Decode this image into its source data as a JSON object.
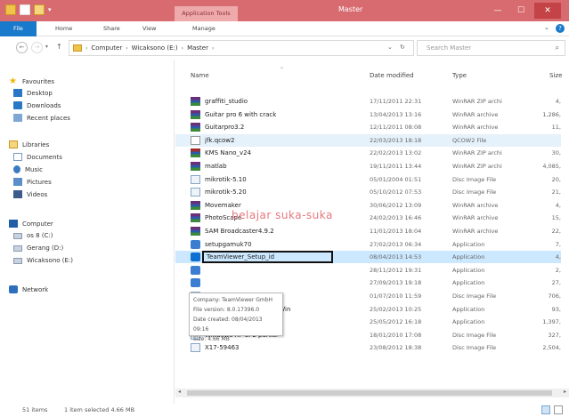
{
  "titlebar": {
    "contextual_tab": "Application Tools",
    "window_title": "Master",
    "minimize": "—",
    "maximize": "☐",
    "close": "✕"
  },
  "ribbon": {
    "tabs": [
      "File",
      "Home",
      "Share",
      "View",
      "Manage"
    ]
  },
  "address": {
    "path": [
      "Computer",
      "Wicaksono (E:)",
      "Master"
    ],
    "search_placeholder": "Search Master"
  },
  "nav": {
    "items": [
      {
        "label": "Favourites",
        "icon": "star-icon"
      },
      {
        "label": "Desktop",
        "icon": "desktop-icon"
      },
      {
        "label": "Downloads",
        "icon": "downloads-icon"
      },
      {
        "label": "Recent places",
        "icon": "recent-places-icon"
      },
      {
        "label": "Libraries",
        "icon": "libraries-icon"
      },
      {
        "label": "Documents",
        "icon": "documents-icon"
      },
      {
        "label": "Music",
        "icon": "music-icon"
      },
      {
        "label": "Pictures",
        "icon": "pictures-icon"
      },
      {
        "label": "Videos",
        "icon": "videos-icon"
      },
      {
        "label": "Computer",
        "icon": "computer-icon"
      },
      {
        "label": "os 8 (C:)",
        "icon": "drive-icon"
      },
      {
        "label": "Gerang (D:)",
        "icon": "drive-icon"
      },
      {
        "label": "Wicaksono (E:)",
        "icon": "drive-icon"
      },
      {
        "label": "Network",
        "icon": "network-icon"
      }
    ]
  },
  "columns": {
    "name": "Name",
    "date": "Date modified",
    "type": "Type",
    "size": "Size"
  },
  "files": [
    {
      "name": "graffiti_studio",
      "date": "17/11/2011 22:31",
      "type": "WinRAR ZIP archi",
      "size": "4,",
      "icon": "rar"
    },
    {
      "name": "Guitar pro 6 with crack",
      "date": "13/04/2013 13:16",
      "type": "WinRAR archive",
      "size": "1,286,",
      "icon": "rar"
    },
    {
      "name": "Guitarpro3.2",
      "date": "12/11/2011 08:08",
      "type": "WinRAR archive",
      "size": "11,",
      "icon": "rar"
    },
    {
      "name": "jfk.qcow2",
      "date": "22/03/2013 18:18",
      "type": "QCOW2 File",
      "size": "",
      "icon": "qcow"
    },
    {
      "name": "KMS Nano_v24",
      "date": "22/02/2013 13:02",
      "type": "WinRAR ZIP archi",
      "size": "30,",
      "icon": "rarb"
    },
    {
      "name": "matlab",
      "date": "19/11/2011 13:44",
      "type": "WinRAR ZIP archi",
      "size": "4,085,",
      "icon": "rar"
    },
    {
      "name": "mikrotik-5.10",
      "date": "05/01/2004 01:51",
      "type": "Disc Image File",
      "size": "20,",
      "icon": "iso"
    },
    {
      "name": "mikrotik-5.20",
      "date": "05/10/2012 07:53",
      "type": "Disc Image File",
      "size": "21,",
      "icon": "iso"
    },
    {
      "name": "Movemaker",
      "date": "30/06/2012 13:09",
      "type": "WinRAR archive",
      "size": "4,",
      "icon": "rar"
    },
    {
      "name": "PhotoScape",
      "date": "24/02/2013 16:46",
      "type": "WinRAR archive",
      "size": "15,",
      "icon": "rar"
    },
    {
      "name": "SAM Broadcaster4.9.2",
      "date": "11/01/2013 18:04",
      "type": "WinRAR archive",
      "size": "22,",
      "icon": "rar"
    },
    {
      "name": "setupgamuk70",
      "date": "27/02/2013 06:34",
      "type": "Application",
      "size": "7,",
      "icon": "app"
    },
    {
      "name": "TeamViewer_Setup_id",
      "date": "08/04/2013 14:53",
      "type": "Application",
      "size": "4,",
      "icon": "tv"
    },
    {
      "name": "",
      "date": "28/11/2012 19:31",
      "type": "Application",
      "size": "2,",
      "icon": "app"
    },
    {
      "name": "",
      "date": "27/09/2013 19:18",
      "type": "Application",
      "size": "27,",
      "icon": "app"
    },
    {
      "name": "",
      "date": "01/07/2010 11:59",
      "type": "Disc Image File",
      "size": "706,",
      "icon": "iso"
    },
    {
      "name": "VirtualBox-4.2.6-82870-Win",
      "date": "25/02/2013 10:25",
      "type": "Application",
      "size": "93,",
      "icon": "vbox"
    },
    {
      "name": "VS65_Pro_TBVB",
      "date": "25/05/2012 16:18",
      "type": "Application",
      "size": "1,397,",
      "icon": "iso"
    },
    {
      "name": "Windows XP SP2 partisi",
      "date": "18/01/2010 17:08",
      "type": "Disc Image File",
      "size": "327,",
      "icon": "iso"
    },
    {
      "name": "X17-59463",
      "date": "23/08/2012 18:38",
      "type": "Disc Image File",
      "size": "2,504,",
      "icon": "iso"
    }
  ],
  "tooltip": {
    "company": "Company: TeamViewer GmbH",
    "version": "File version: 8.0.17396.0",
    "created": "Date created: 08/04/2013 09:16",
    "size": "Size: 4.66 MB"
  },
  "watermark": "belajar suka-suka",
  "status": {
    "items": "51 items",
    "selected": "1 item selected  4.66 MB"
  },
  "colors": {
    "titlebar": "#d86b6f",
    "file_tab": "#1979ca",
    "selection": "#cce8ff",
    "hover": "#e5f1fb"
  }
}
